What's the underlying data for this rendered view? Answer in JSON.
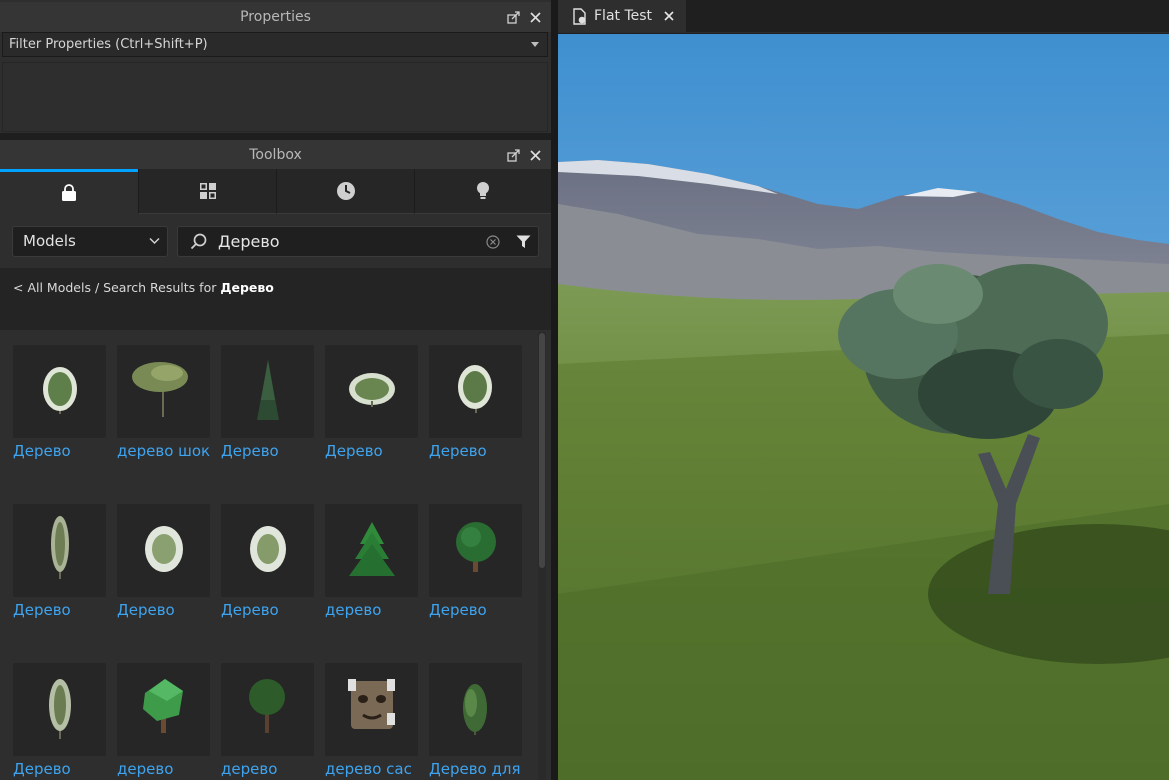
{
  "properties": {
    "title": "Properties",
    "filter_placeholder": "Filter Properties (Ctrl+Shift+P)"
  },
  "toolbox": {
    "title": "Toolbox",
    "tabs": [
      {
        "name": "marketplace",
        "icon": "shopping-bag-icon"
      },
      {
        "name": "inventory",
        "icon": "grid-icon"
      },
      {
        "name": "recent",
        "icon": "clock-icon"
      },
      {
        "name": "creations",
        "icon": "lightbulb-icon"
      }
    ],
    "category": "Models",
    "search_value": "Дерево",
    "breadcrumb_back": "< All Models",
    "breadcrumb_sep": " / ",
    "breadcrumb_prefix": "Search Results for ",
    "breadcrumb_query": "Дерево",
    "items": [
      {
        "label": "Дерево",
        "icon": "round-tree-icon"
      },
      {
        "label": "дерево шок",
        "icon": "acacia-tree-icon"
      },
      {
        "label": "Дерево",
        "icon": "pine-tree-icon"
      },
      {
        "label": "Дерево",
        "icon": "bush-icon"
      },
      {
        "label": "Дерево",
        "icon": "round-tree-icon"
      },
      {
        "label": "Дерево",
        "icon": "tall-tree-icon"
      },
      {
        "label": "Дерево",
        "icon": "bush-icon"
      },
      {
        "label": "Дерево",
        "icon": "bush-icon"
      },
      {
        "label": "дерево",
        "icon": "low-poly-pine-icon"
      },
      {
        "label": "Дерево",
        "icon": "green-tree-icon"
      },
      {
        "label": "Дерево",
        "icon": "tall-tree-icon"
      },
      {
        "label": "дерево",
        "icon": "cube-tree-icon"
      },
      {
        "label": "дерево",
        "icon": "ball-tree-icon"
      },
      {
        "label": "дерево сас",
        "icon": "face-icon"
      },
      {
        "label": "Дерево для",
        "icon": "shrub-icon"
      }
    ]
  },
  "document": {
    "tab_title": "Flat Test"
  },
  "colors": {
    "accent": "#00a2ff",
    "link": "#3ea4f0",
    "sky": "#5aa6dc",
    "grass": "#5c7c30"
  }
}
